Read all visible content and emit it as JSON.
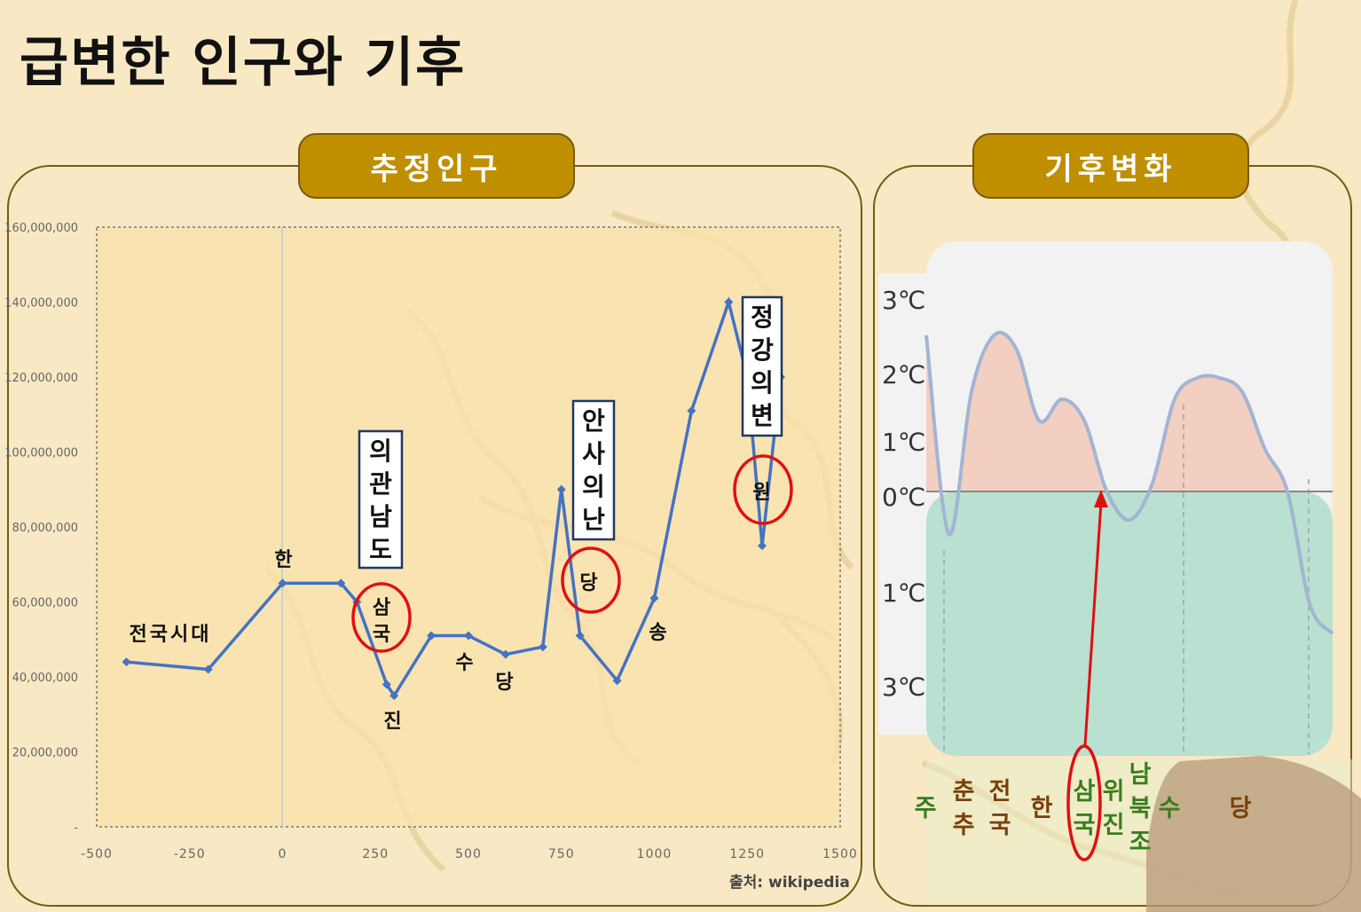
{
  "slide": {
    "title": "급변한 인구와 기후"
  },
  "left_panel": {
    "tab_label": "추정인구",
    "source": "출처: wikipedia"
  },
  "right_panel": {
    "tab_label": "기후변화"
  },
  "colors": {
    "line": "#4472c4",
    "tab": "#bf8f00",
    "warm_fill": "#f2cfc0",
    "cool_fill": "#b9e0d0",
    "circle": "#e01010",
    "label_green": "#3a7d1e",
    "label_brown": "#7a3f0a"
  },
  "chart_data": [
    {
      "type": "line",
      "title": "추정인구",
      "xlim": [
        -500,
        1500
      ],
      "ylim": [
        0,
        160000000
      ],
      "x_ticks": [
        "-500",
        "-250",
        "0",
        "250",
        "500",
        "750",
        "1000",
        "1250",
        "1500"
      ],
      "y_ticks": [
        "-",
        "20,000,000",
        "40,000,000",
        "60,000,000",
        "80,000,000",
        "100,000,000",
        "120,000,000",
        "140,000,000",
        "160,000,000"
      ],
      "grid": false,
      "series": [
        {
          "x": [
            -420,
            -200,
            0,
            157,
            200,
            280,
            300,
            400,
            500,
            600,
            700,
            750,
            800,
            900,
            1000,
            1100,
            1200,
            1250,
            1290,
            1340
          ],
          "y": [
            44000000,
            42000000,
            65000000,
            65000000,
            60000000,
            38000000,
            35000000,
            51000000,
            51000000,
            46000000,
            48000000,
            90000000,
            51000000,
            39000000,
            61000000,
            111000000,
            140000000,
            120000000,
            75000000,
            120000000
          ]
        }
      ],
      "annotations": [
        {
          "text": "전국시대"
        },
        {
          "text": "한"
        },
        {
          "text": "진"
        },
        {
          "text": "삼국",
          "circled": true
        },
        {
          "text": "수"
        },
        {
          "text": "당"
        },
        {
          "text": "당",
          "circled": true
        },
        {
          "text": "송"
        },
        {
          "text": "원",
          "circled": true
        },
        {
          "text": "의관남도",
          "boxed": true
        },
        {
          "text": "안사의난",
          "boxed": true
        },
        {
          "text": "정강의변",
          "boxed": true
        }
      ]
    },
    {
      "type": "area",
      "title": "기후변화",
      "y_labels": [
        "3℃",
        "2℃",
        "1℃",
        "0℃",
        "1℃",
        "3℃"
      ],
      "y_values": [
        3,
        2,
        1,
        0,
        -1,
        -3
      ],
      "series": [
        {
          "y": [
            2.2,
            -0.6,
            1.4,
            2.2,
            2.0,
            1.0,
            1.3,
            1.0,
            0.0,
            -0.4,
            0.1,
            1.3,
            1.6,
            1.6,
            1.4,
            0.6,
            0.0,
            -1.6,
            -2.0
          ]
        }
      ],
      "dynasties": [
        {
          "label": "주",
          "color": "green"
        },
        {
          "label": "춘추",
          "color": "brown"
        },
        {
          "label": "전국",
          "color": "brown"
        },
        {
          "label": "한",
          "color": "brown"
        },
        {
          "label": "삼국",
          "color": "green",
          "circled": true
        },
        {
          "label": "위진",
          "color": "green"
        },
        {
          "label": "남북조",
          "color": "green"
        },
        {
          "label": "수",
          "color": "green"
        },
        {
          "label": "당",
          "color": "brown"
        }
      ]
    }
  ]
}
